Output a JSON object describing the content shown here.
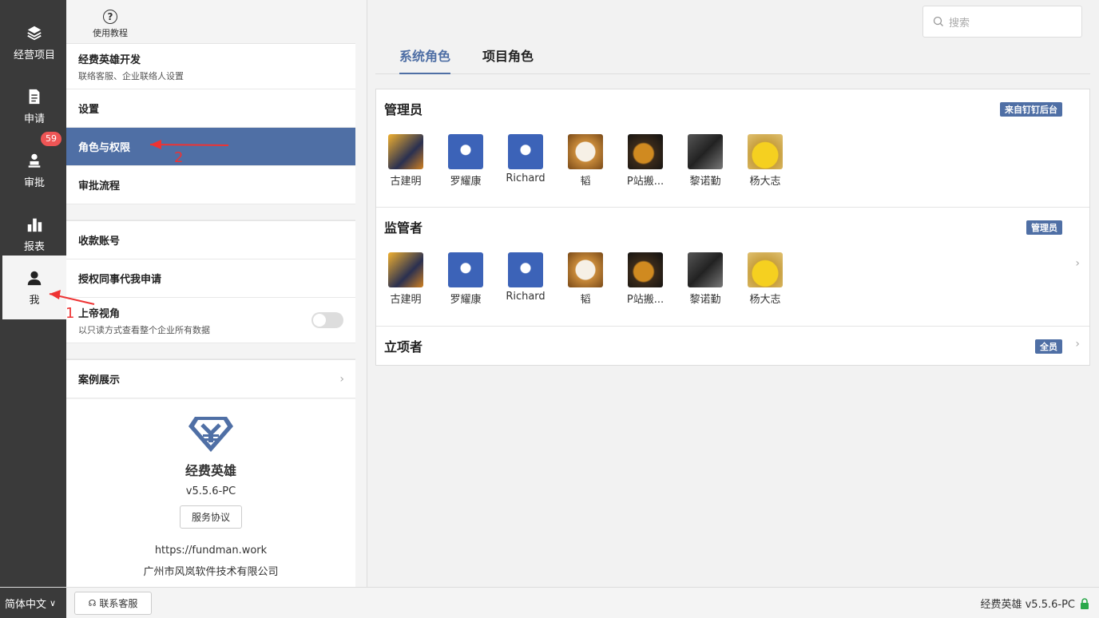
{
  "rail": {
    "items": [
      {
        "label": "经营项目",
        "icon": "layers-icon"
      },
      {
        "label": "申请",
        "icon": "document-icon"
      },
      {
        "label": "审批",
        "icon": "stamp-icon",
        "badge": "59"
      },
      {
        "label": "报表",
        "icon": "bar-chart-icon"
      },
      {
        "label": "我",
        "icon": "user-icon"
      }
    ]
  },
  "help": {
    "label": "使用教程"
  },
  "menu": {
    "company": {
      "title": "经费英雄开发",
      "subtitle": "联络客服、企业联络人设置"
    },
    "settings": "设置",
    "roles": "角色与权限",
    "approval_flow": "审批流程",
    "payment_account": "收款账号",
    "delegate": "授权同事代我申请",
    "god_view": {
      "title": "上帝视角",
      "subtitle": "以只读方式查看整个企业所有数据",
      "enabled": false
    },
    "showcase": "案例展示"
  },
  "about": {
    "name": "经费英雄",
    "version": "v5.5.6-PC",
    "agreement": "服务协议",
    "url": "https://fundman.work",
    "company": "广州市风岚软件技术有限公司"
  },
  "search": {
    "placeholder": "搜索"
  },
  "tabs": [
    {
      "label": "系统角色",
      "active": true
    },
    {
      "label": "项目角色",
      "active": false
    }
  ],
  "roles": [
    {
      "title": "管理员",
      "tag": "来自钉钉后台",
      "members": [
        "古建明",
        "罗耀康",
        "Richard",
        "韬",
        "P站搬...",
        "黎诺勤",
        "杨大志"
      ]
    },
    {
      "title": "监管者",
      "tag": "管理员",
      "members": [
        "古建明",
        "罗耀康",
        "Richard",
        "韬",
        "P站搬...",
        "黎诺勤",
        "杨大志"
      ]
    },
    {
      "title": "立项者",
      "tag": "全员",
      "members": []
    }
  ],
  "bottom": {
    "language": "简体中文",
    "support": "联系客服",
    "version": "经费英雄 v5.5.6-PC"
  },
  "annotations": [
    "1",
    "2"
  ],
  "colors": {
    "accent": "#4f6fa5",
    "rail": "#3a3a3a",
    "badge": "#e55555",
    "annotation": "#e33333"
  }
}
